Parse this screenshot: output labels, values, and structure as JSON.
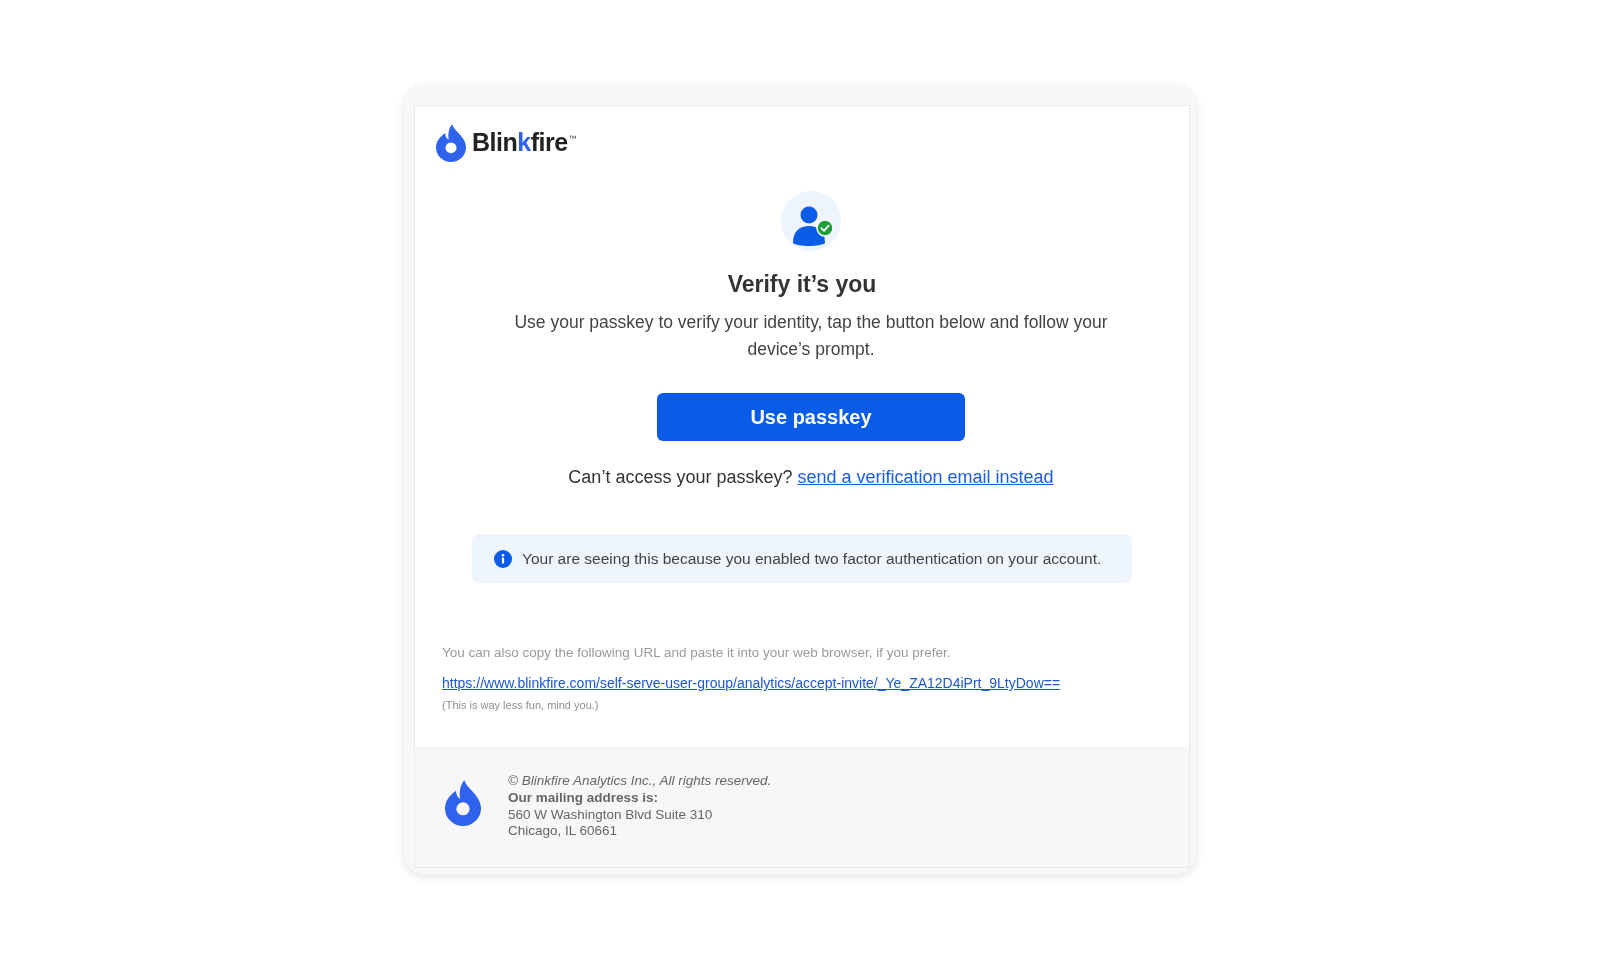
{
  "logo": {
    "wordmark": [
      {
        "text": "Blin",
        "accent": false
      },
      {
        "text": "k",
        "accent": true
      },
      {
        "text": "fire",
        "accent": false
      }
    ],
    "trademark": "™"
  },
  "heading": "Verify it’s you",
  "message": "Use your passkey to verify your identity, tap the button below and follow your device’s prompt.",
  "primary_button": "Use passkey",
  "fallback": {
    "question": "Can’t access your passkey?",
    "link": "send a verification email instead"
  },
  "notice": "Your are seeing this because you enabled two factor authentication on your account.",
  "url_section": {
    "intro": "You can also copy the following URL and paste it into your web browser, if you prefer.",
    "url": "https://www.blinkfire.com/self-serve-user-group/analytics/accept-invite/_Ye_ZA12D4iPrt_9LtyDow==",
    "note": "(This is way less fun, mind you.)"
  },
  "footer": {
    "lines": [
      {
        "text": "© Blinkfire Analytics Inc., All rights reserved.",
        "kind": "italic"
      },
      {
        "text": "Our mailing address is:",
        "kind": "bold"
      },
      {
        "text": "560 W Washington Blvd Suite 310",
        "kind": "plain"
      },
      {
        "text": "Chicago, IL 60661",
        "kind": "plain"
      }
    ]
  }
}
